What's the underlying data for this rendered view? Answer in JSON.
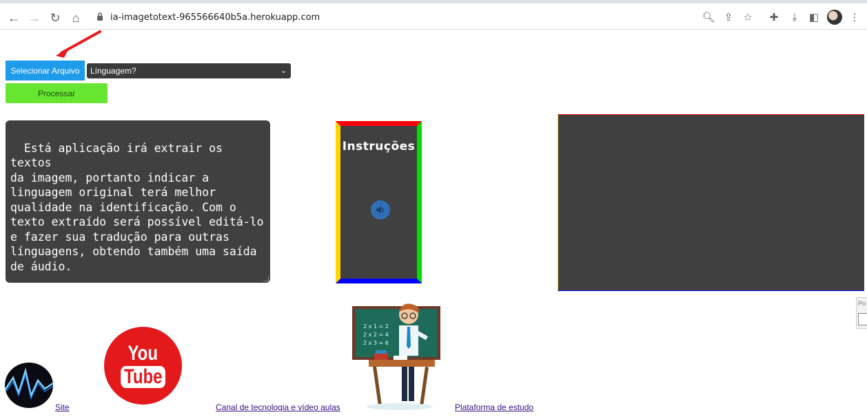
{
  "browser": {
    "url": "ia-imagetotext-965566640b5a.herokuapp.com"
  },
  "controls": {
    "select_file_label": "Selecionar Arquivo",
    "language_select_value": "Línguagem?",
    "process_label": "Processar"
  },
  "description": {
    "text": "Está aplicação irá extrair os textos\nda imagem, portanto indicar a\nlinguagem original terá melhor\nqualidade na identificação. Com o\ntexto extraído será possível editá-lo\ne fazer sua tradução para outras\nlínguagens, obtendo também uma saída\nde áudio."
  },
  "instructions": {
    "title": "Instruções"
  },
  "side_widget": {
    "text": "Po"
  },
  "youtube_logo": {
    "you": "You",
    "tube": "Tube"
  },
  "footer": {
    "site_link": "Site",
    "channel_link": "Canal de tecnologia e vídeo aulas",
    "platform_link": "Plataforma de estudo"
  },
  "colors": {
    "select_file_button": "#1e9bea",
    "process_button": "#66e630",
    "panel_bg": "#404040",
    "link": "#3b0f80",
    "youtube_red": "#e3191c"
  },
  "icons": [
    "back-arrow-icon",
    "forward-arrow-icon",
    "reload-icon",
    "home-icon",
    "lock-icon",
    "zoom-icon",
    "share-icon",
    "star-icon",
    "extensions-icon",
    "download-icon",
    "sidebar-icon",
    "profile-avatar",
    "kebab-menu-icon",
    "speaker-icon",
    "red-arrow-annotation"
  ]
}
